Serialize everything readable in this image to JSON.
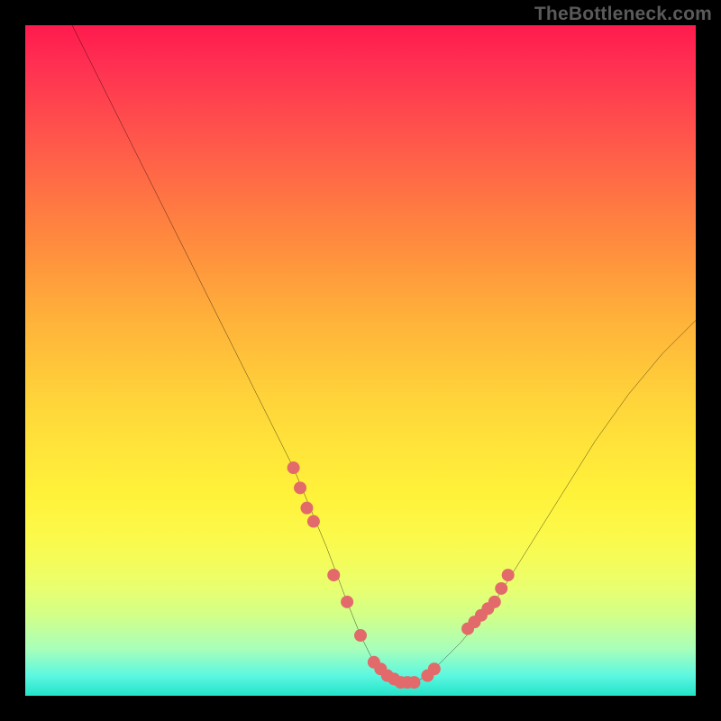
{
  "watermark": "TheBottleneck.com",
  "chart_data": {
    "type": "line",
    "title": "",
    "xlabel": "",
    "ylabel": "",
    "xlim": [
      0,
      100
    ],
    "ylim": [
      0,
      100
    ],
    "grid": false,
    "legend": false,
    "series": [
      {
        "name": "bottleneck-curve",
        "color": "#000000",
        "x": [
          7,
          10,
          15,
          20,
          25,
          30,
          35,
          40,
          45,
          48,
          50,
          52,
          54,
          56,
          58,
          60,
          62,
          65,
          70,
          75,
          80,
          85,
          90,
          95,
          100
        ],
        "y": [
          100,
          94,
          84,
          74,
          64,
          54,
          44,
          34,
          22,
          14,
          9,
          5,
          3,
          2,
          2,
          3,
          5,
          8,
          14,
          22,
          30,
          38,
          45,
          51,
          56
        ]
      }
    ],
    "markers": [
      {
        "name": "highlight-dots",
        "color": "#e36a6a",
        "radius_px": 7,
        "x": [
          40,
          41,
          42,
          43,
          46,
          48,
          50,
          52,
          53,
          54,
          55,
          56,
          57,
          58,
          60,
          61,
          66,
          67,
          68,
          69,
          70,
          71,
          72
        ],
        "y": [
          34,
          31,
          28,
          26,
          18,
          14,
          9,
          5,
          4,
          3,
          2.5,
          2,
          2,
          2,
          3,
          4,
          10,
          11,
          12,
          13,
          14,
          16,
          18
        ]
      }
    ],
    "background_gradient": {
      "top": "#ff1a4d",
      "mid": "#fff23a",
      "bottom": "#23e3c9"
    }
  }
}
